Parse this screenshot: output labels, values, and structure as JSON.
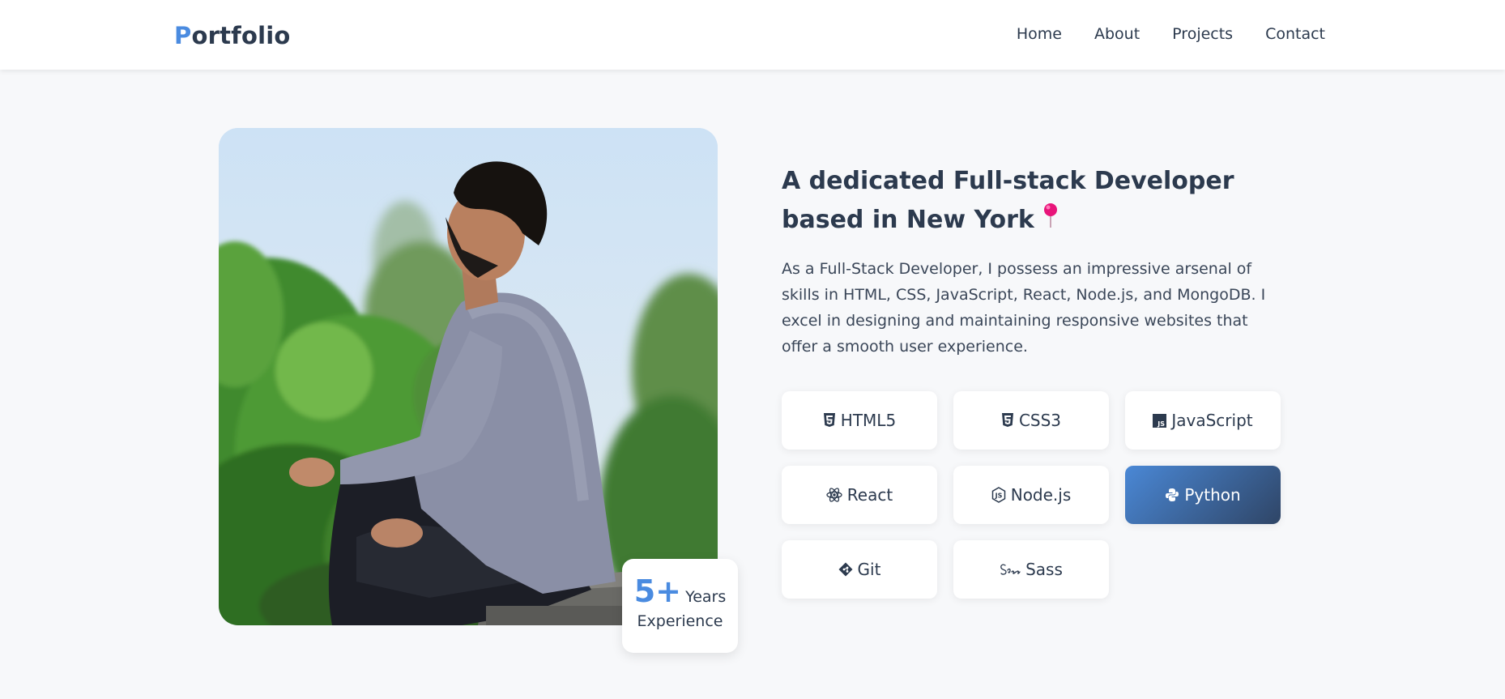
{
  "nav": {
    "logo_first": "P",
    "logo_rest": "ortfolio",
    "links": [
      "Home",
      "About",
      "Projects",
      "Contact"
    ]
  },
  "hero": {
    "headline": "A dedicated Full-stack Developer based in New York",
    "description": "As a Full-Stack Developer, I possess an impressive arsenal of skills in HTML, CSS, JavaScript, React, Node.js, and MongoDB. I excel in designing and maintaining responsive websites that offer a smooth user experience.",
    "experience": {
      "number": "5+",
      "unit": "Years",
      "label": "Experience"
    }
  },
  "skills": [
    {
      "label": "HTML5",
      "icon": "html5-icon",
      "active": false
    },
    {
      "label": "CSS3",
      "icon": "css3-icon",
      "active": false
    },
    {
      "label": "JavaScript",
      "icon": "javascript-icon",
      "active": false
    },
    {
      "label": "React",
      "icon": "react-icon",
      "active": false
    },
    {
      "label": "Node.js",
      "icon": "nodejs-icon",
      "active": false
    },
    {
      "label": "Python",
      "icon": "python-icon",
      "active": true
    },
    {
      "label": "Git",
      "icon": "git-icon",
      "active": false
    },
    {
      "label": "Sass",
      "icon": "sass-icon",
      "active": false
    }
  ],
  "colors": {
    "accent": "#4a8be0",
    "text": "#2c3a4e",
    "background": "#f7f8fa",
    "active_gradient_start": "#4a88d6",
    "active_gradient_end": "#2f4566",
    "pin": "#e8157a"
  }
}
